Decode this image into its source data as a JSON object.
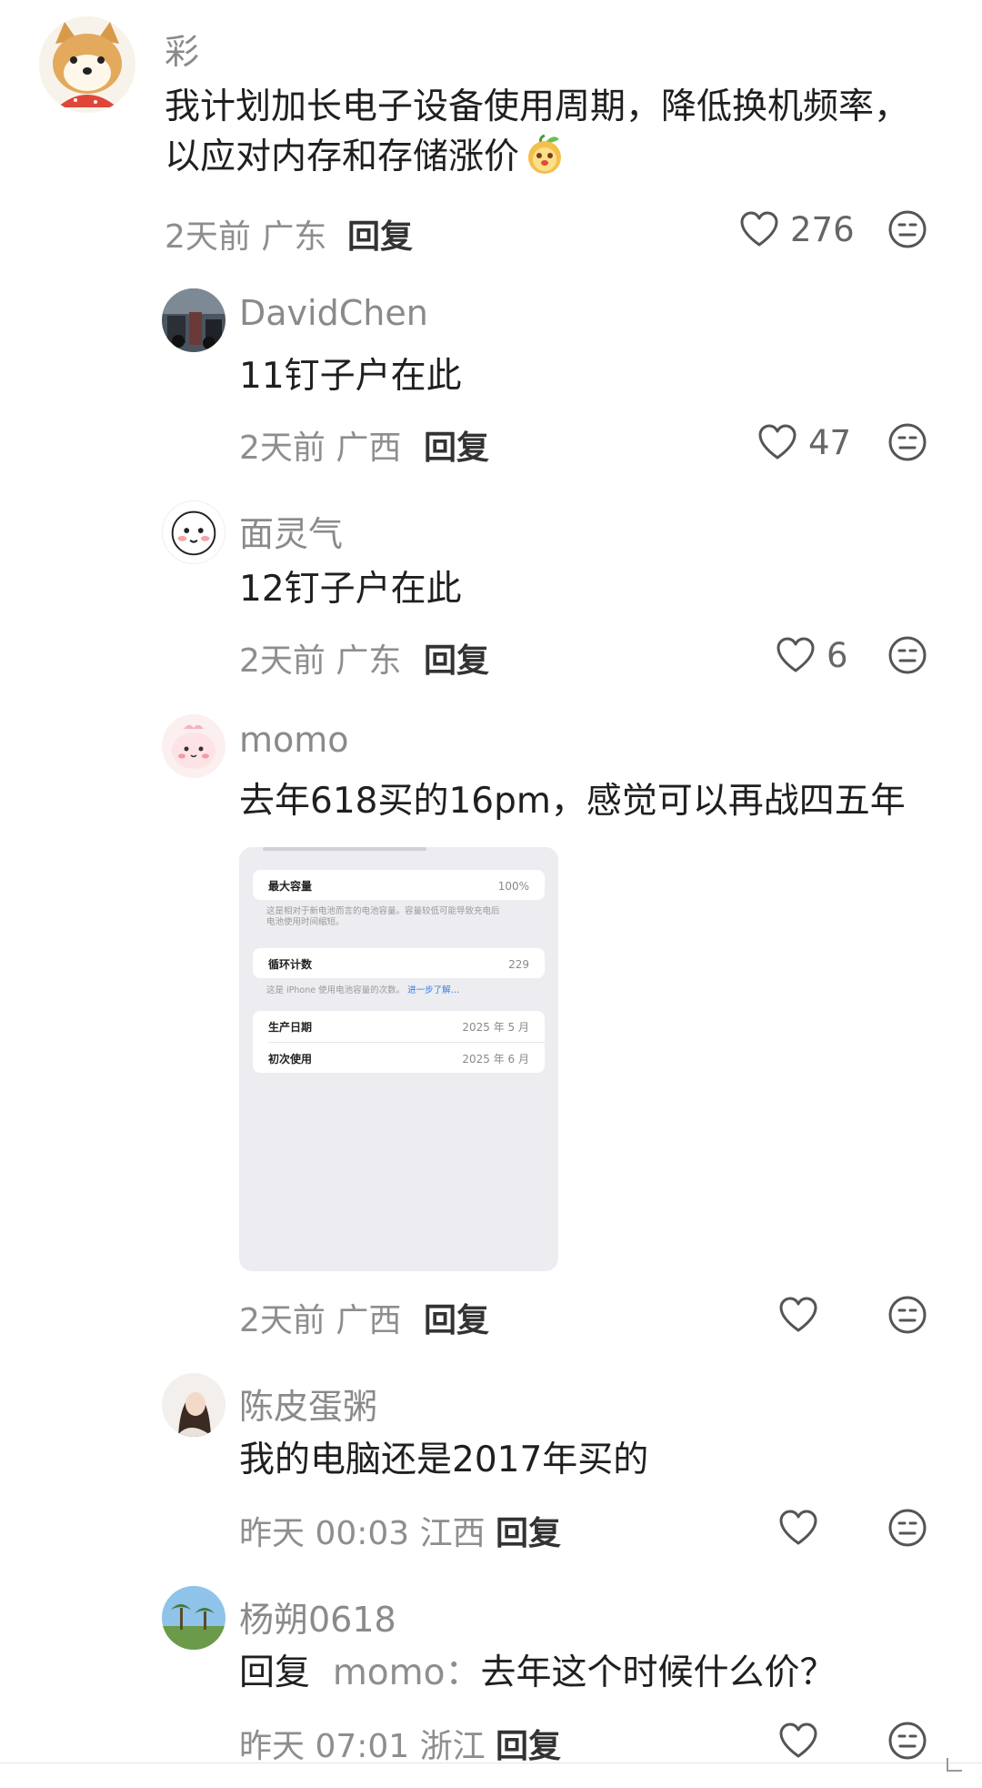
{
  "comments": [
    {
      "username": "彩",
      "text": "我计划加长电子设备使用周期，降低换机频率，",
      "text2": "以应对内存和存储涨价",
      "meta": "2天前 广东",
      "reply": "回复",
      "likes": "276"
    },
    {
      "username": "DavidChen",
      "text": "11钉子户在此",
      "meta": "2天前 广西",
      "reply": "回复",
      "likes": "47"
    },
    {
      "username": "面灵气",
      "text": "12钉子户在此",
      "meta": "2天前 广东",
      "reply": "回复",
      "likes": "6"
    },
    {
      "username": "momo",
      "text": "去年618买的16pm，感觉可以再战四五年",
      "meta": "2天前 广西",
      "reply": "回复",
      "likes": "",
      "attachment": {
        "max_capacity_label": "最大容量",
        "max_capacity_value": "100%",
        "capacity_note_1": "这是相对于新电池而言的电池容量。容量较低可能导致充电后",
        "capacity_note_2": "电池使用时间缩短。",
        "cycle_label": "循环计数",
        "cycle_value": "229",
        "cycle_note": "这是 iPhone 使用电池容量的次数。",
        "cycle_link": "进一步了解…",
        "mfg_label": "生产日期",
        "mfg_value": "2025 年 5 月",
        "first_use_label": "初次使用",
        "first_use_value": "2025 年 6 月"
      }
    },
    {
      "username": "陈皮蛋粥",
      "text": "我的电脑还是2017年买的",
      "meta": "昨天 00:03 江西",
      "reply": "回复",
      "likes": ""
    },
    {
      "username": "杨朔0618",
      "text_prefix": "回复",
      "mention": "momo：",
      "text": "去年这个时候什么价？",
      "meta": "昨天 07:01 浙江",
      "reply": "回复",
      "likes": ""
    }
  ],
  "icons": {
    "like": "heart-outline-icon",
    "react": "neutral-face-icon",
    "inline_emoji": "peach-face-emoji"
  }
}
